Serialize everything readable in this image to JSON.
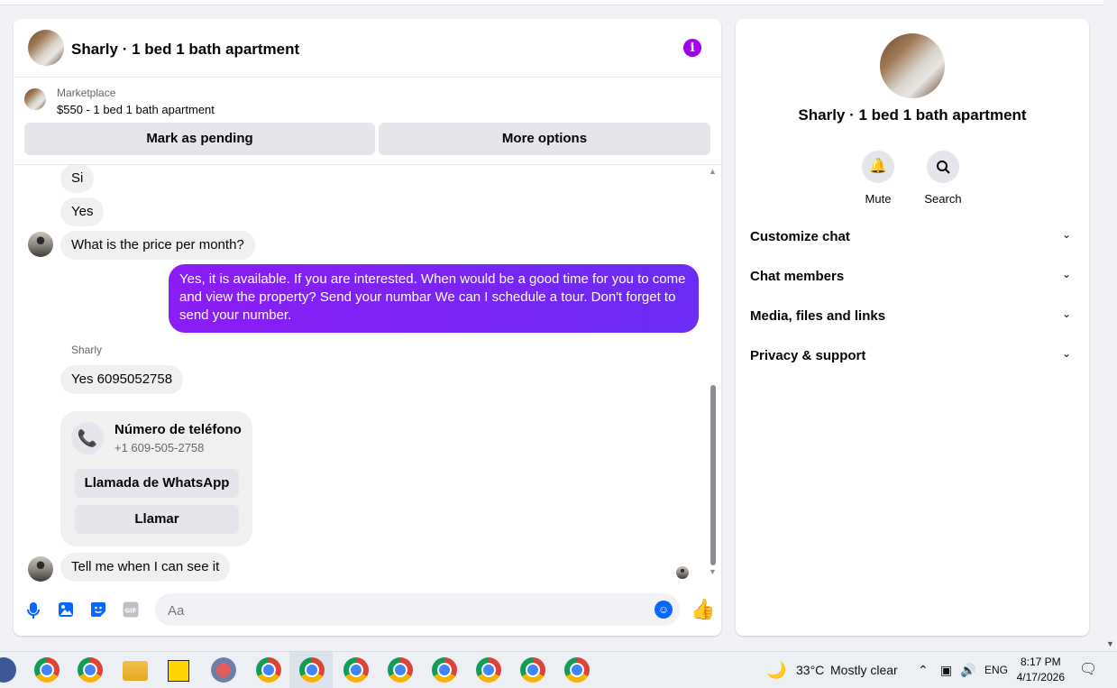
{
  "chat_header": {
    "title": "Sharly · 1 bed 1 bath apartment",
    "info_icon": "i"
  },
  "marketplace": {
    "label": "Marketplace",
    "listing": "$550 - 1 bed 1 bath apartment",
    "pending_button": "Mark as pending",
    "more_button": "More options"
  },
  "messages": {
    "m1": "Si",
    "m2": "Yes",
    "m3": "What is the price per month?",
    "outgoing": "Yes, it is available. If you are interested.   When would be a good time for you to come and view the property? Send your numbar We can I schedule a tour.  Don't forget to send your number.",
    "sender_name": "Sharly",
    "m4": "Yes 6095052758",
    "m5": "Tell me when I can see it"
  },
  "phone_card": {
    "title": "Número de teléfono",
    "number": "+1 609-505-2758",
    "whatsapp_button": "Llamada de WhatsApp",
    "call_button": "Llamar"
  },
  "composer": {
    "placeholder": "Aa",
    "gif": "GIF"
  },
  "info_panel": {
    "title": "Sharly · 1 bed 1 bath apartment",
    "mute_label": "Mute",
    "search_label": "Search",
    "sections": [
      "Customize chat",
      "Chat members",
      "Media, files and links",
      "Privacy & support"
    ]
  },
  "taskbar": {
    "weather_temp": "33°C",
    "weather_text": "Mostly clear",
    "language": "ENG",
    "time": "8:17 PM",
    "date": "4/17/2026"
  },
  "colors": {
    "accent": "#0866ff",
    "outgoing_bubble": "#7b22f5",
    "info_icon": "#a100f2"
  }
}
